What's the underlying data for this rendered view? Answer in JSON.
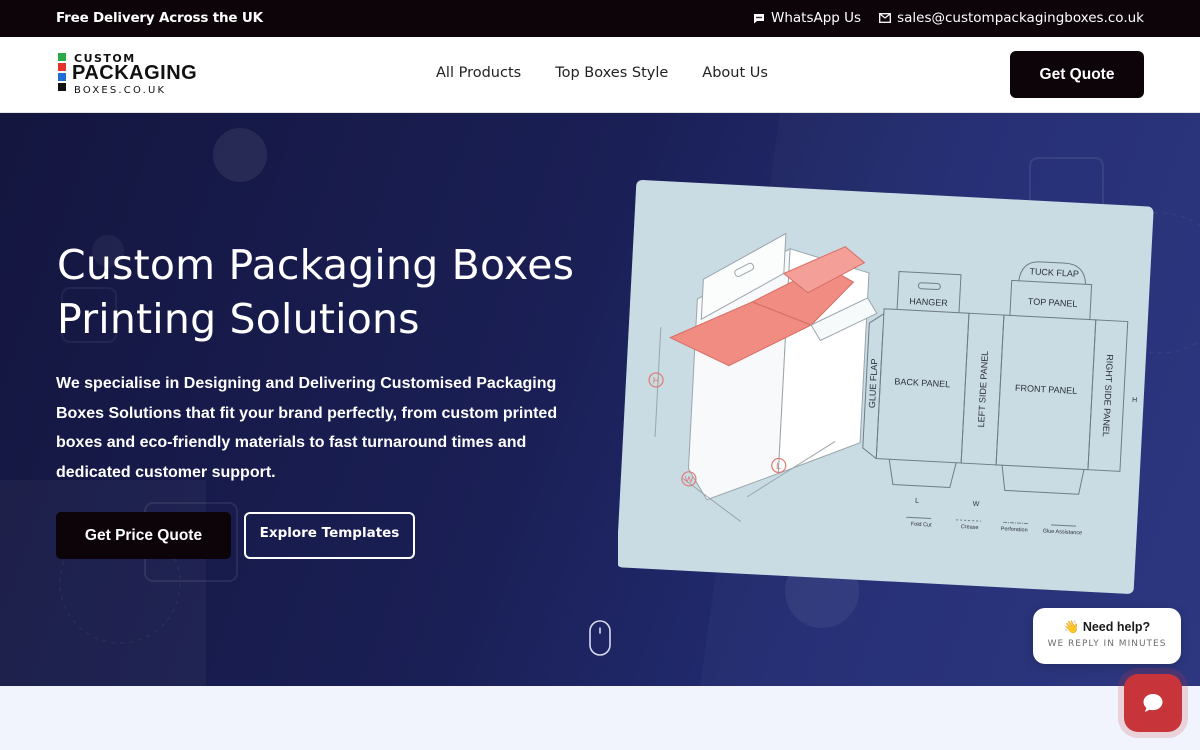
{
  "topbar": {
    "delivery_text": "Free Delivery Across the UK",
    "whatsapp_label": "WhatsApp Us",
    "email": "sales@custompackagingboxes.co.uk",
    "icons": [
      "chat-bubble-icon",
      "mail-icon"
    ]
  },
  "header": {
    "logo": {
      "line1": "CUSTOM",
      "line2": "PACKAGING",
      "line3": "BOXES.CO.UK",
      "square_colors": [
        "#2aa84a",
        "#e5322d",
        "#1f6fd6",
        "#111111"
      ]
    },
    "nav": [
      "All Products",
      "Top Boxes Style",
      "About Us"
    ],
    "cta_label": "Get Quote"
  },
  "hero": {
    "title_line1": "Custom Packaging Boxes",
    "title_line2": "Printing Solutions",
    "description": "We specialise in Designing and Delivering Customised Packaging Boxes Solutions that fit your brand perfectly, from custom printed boxes and eco-friendly materials to fast turnaround times and dedicated customer support.",
    "primary_button": "Get Price Quote",
    "secondary_button": "Explore Templates",
    "dieline": {
      "labels": {
        "tuck_flap": "TUCK FLAP",
        "top_panel": "TOP PANEL",
        "hanger": "HANGER",
        "back_panel": "BACK PANEL",
        "glue_flap": "GLUE FLAP",
        "left_side_panel": "LEFT SIDE PANEL",
        "front_panel": "FRONT PANEL",
        "right_side_panel": "RIGHT SIDE PANEL",
        "h": "H",
        "w": "W",
        "l": "L",
        "dim_l": "L",
        "dim_w": "W",
        "dim_h": "H"
      },
      "legend": [
        "Fold Cut",
        "Crease",
        "Perforation",
        "Glue Assistance"
      ],
      "colors": {
        "panel": "#c9dbe3",
        "flap": "#f08c82",
        "dimension": "#e07a74"
      }
    }
  },
  "chat": {
    "title": "👋 Need help?",
    "subtitle": "WE REPLY IN MINUTES",
    "button_color": "#c7353b"
  },
  "colors": {
    "topbar_bg": "#0c0408",
    "hero_bg": "#1a1f55",
    "lower_bg": "#f1f4fd"
  }
}
